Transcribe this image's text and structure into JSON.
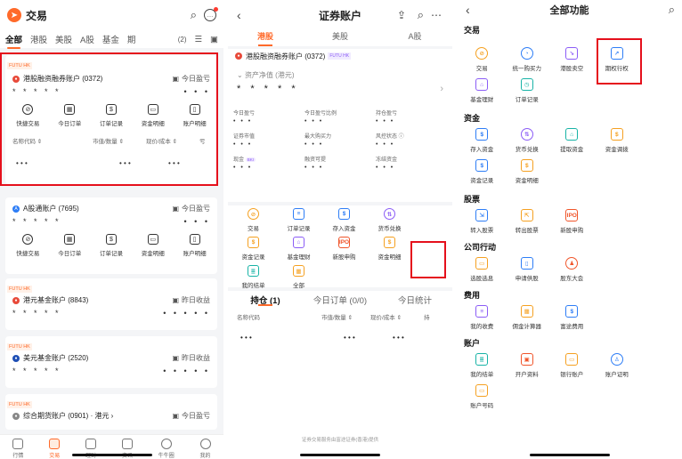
{
  "colors": {
    "accent": "#ff6a2a",
    "highlight": "#e5101c"
  },
  "p1": {
    "title": "交易",
    "tabs": [
      "全部",
      "港股",
      "美股",
      "A股",
      "基金",
      "期"
    ],
    "tab_count": "(2)",
    "cards": [
      {
        "tag": "FUTU HK",
        "name": "港股融资融券账户 (0372)",
        "right": "今日盈亏",
        "stars": "* * * * *",
        "stars_r": "• • •",
        "actions": [
          "快捷交易",
          "今日订单",
          "订单记录",
          "资金明细",
          "账户明细"
        ],
        "cols": [
          "名称代码 ⇕",
          "市值/数量 ⇕",
          "现价/成本 ⇕",
          "亏"
        ],
        "vals": [
          "• • •",
          "• • •",
          "• • •"
        ]
      },
      {
        "name": "A股通账户 (7695)",
        "right": "今日盈亏",
        "stars": "* * * * *",
        "stars_r": "• • •",
        "actions": [
          "快捷交易",
          "今日订单",
          "订单记录",
          "资金明细",
          "账户明细"
        ]
      },
      {
        "tag": "FUTU HK",
        "name": "港元基金账户 (8843)",
        "right": "昨日收益",
        "stars": "* * * * *",
        "stars_r": "• • • • •"
      },
      {
        "tag": "FUTU HK",
        "name": "美元基金账户 (2520)",
        "right": "昨日收益",
        "stars": "* * * * *",
        "stars_r": "• • • • •"
      },
      {
        "tag": "FUTU HK",
        "name": "综合期货账户 (0901) · 港元 ›",
        "right": "今日盈亏"
      }
    ],
    "nav": [
      "行情",
      "交易",
      "理财",
      "资讯",
      "牛牛圈",
      "我的"
    ]
  },
  "p2": {
    "title": "证券账户",
    "tabs": [
      "港股",
      "美股",
      "A股"
    ],
    "account": "港股融资融券账户 (0372)",
    "account_tag": "FUTU HK",
    "net_label": "资产净值 (港元)",
    "net_value": "* * * * *",
    "stats": [
      [
        "今日盈亏",
        "今日盈亏比例",
        "持仓盈亏"
      ],
      [
        "证券市值",
        "最大购买力",
        "风控状态 ⓘ"
      ],
      [
        "现金",
        "融资可提",
        "冻结资金"
      ]
    ],
    "stat_val": "• • •",
    "cash_badge": "BKI",
    "fn_row1": [
      "交易",
      "订单记录",
      "存入资金",
      "货币兑换",
      "资金记录"
    ],
    "fn_row2": [
      "基金理财",
      "新股申购",
      "资金明细",
      "我的结单",
      "全部"
    ],
    "pos_tabs": [
      "持仓 (1)",
      "今日订单 (0/0)",
      "今日统计"
    ],
    "pos_cols": [
      "名称代码",
      "市值/数量 ⇕",
      "现价/成本 ⇕",
      "持"
    ],
    "pos_vals": [
      "• • •",
      "• • •",
      "• • •"
    ],
    "footer": "证券交易服务由富途证券(香港)提供"
  },
  "p3": {
    "title": "全部功能",
    "sections": [
      {
        "name": "交易",
        "items": [
          "交易",
          "统一购买力",
          "港股卖空",
          "期权行权",
          "基金理财",
          "订单记录"
        ]
      },
      {
        "name": "资金",
        "items": [
          "存入资金",
          "货币兑换",
          "提取资金",
          "资金调拨",
          "资金记录",
          "资金明细"
        ]
      },
      {
        "name": "股票",
        "items": [
          "转入股票",
          "转出股票",
          "新股申购"
        ]
      },
      {
        "name": "公司行动",
        "items": [
          "选股选息",
          "申请供股",
          "股东大会"
        ]
      },
      {
        "name": "费用",
        "items": [
          "我的收费",
          "佣金计算器",
          "富途费用"
        ]
      },
      {
        "name": "账户",
        "items": [
          "我的结单",
          "开户资料",
          "银行账户",
          "账户证明",
          "账户号码"
        ]
      }
    ]
  }
}
